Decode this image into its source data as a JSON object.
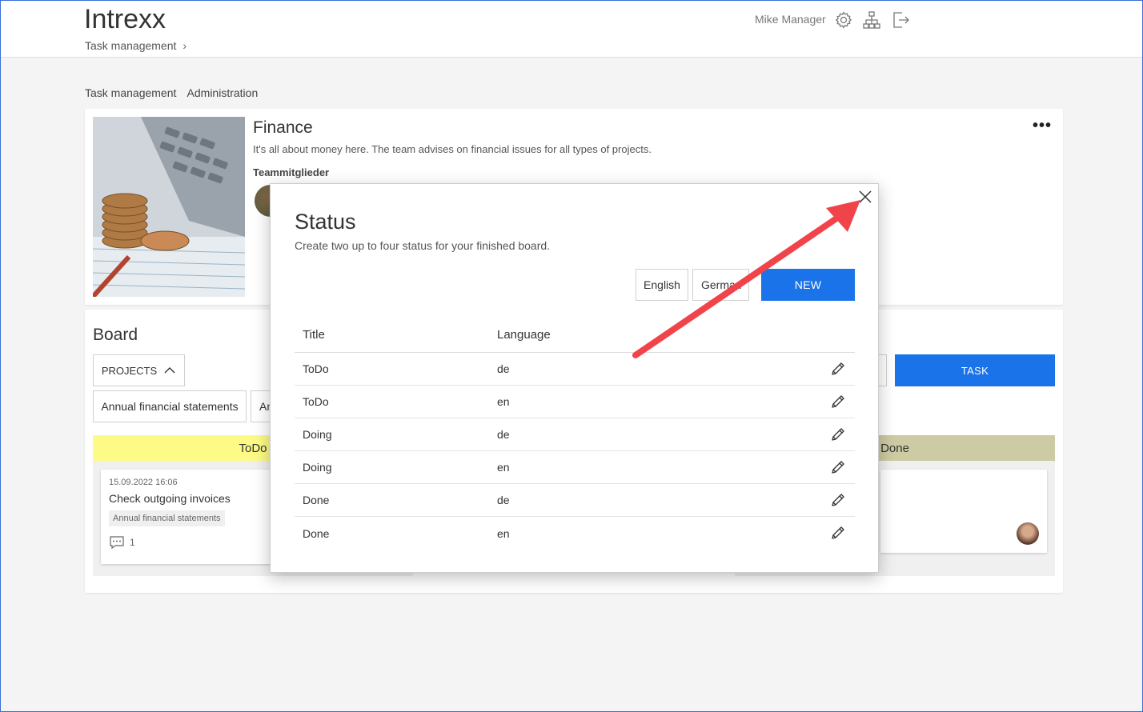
{
  "header": {
    "logo": "Intrexx",
    "breadcrumb": "Task management",
    "user_name": "Mike Manager",
    "icons": [
      "gear-icon",
      "sitemap-icon",
      "logout-icon"
    ]
  },
  "subnav": {
    "items": [
      "Task management",
      "Administration"
    ]
  },
  "team": {
    "title": "Finance",
    "description": "It's all about money here. The team advises on financial issues for all types of projects.",
    "members_label": "Teammitglieder",
    "more": "•••"
  },
  "board": {
    "title": "Board",
    "projects_label": "PROJECTS",
    "filter_1": "Annual financial statements",
    "filter_2": "An",
    "task_button": "TASK",
    "columns": {
      "todo": "ToDo",
      "done": "Done"
    },
    "colors": {
      "todo": "#fdfa85",
      "done": "#cdcba3",
      "accent": "#1a73e8"
    },
    "task": {
      "date": "15.09.2022 16:06",
      "title": "Check outgoing invoices",
      "tag": "Annual financial statements",
      "comments": "1"
    }
  },
  "modal": {
    "title": "Status",
    "subtitle": "Create two up to four status for your finished board.",
    "lang_english": "English",
    "lang_german": "German",
    "new_button": "NEW",
    "columns": {
      "title": "Title",
      "language": "Language"
    },
    "rows": [
      {
        "title": "ToDo",
        "language": "de"
      },
      {
        "title": "ToDo",
        "language": "en"
      },
      {
        "title": "Doing",
        "language": "de"
      },
      {
        "title": "Doing",
        "language": "en"
      },
      {
        "title": "Done",
        "language": "de"
      },
      {
        "title": "Done",
        "language": "en"
      }
    ]
  }
}
